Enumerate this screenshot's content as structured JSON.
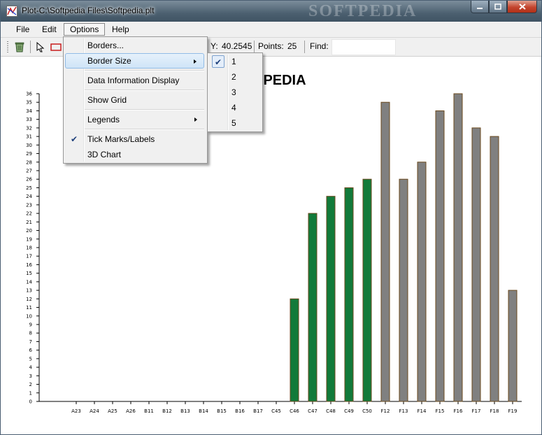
{
  "window": {
    "title": "Plot-C:\\Softpedia Files\\Softpedia.plt",
    "watermark": "SOFTPEDIA"
  },
  "menubar": {
    "file": "File",
    "edit": "Edit",
    "options": "Options",
    "help": "Help"
  },
  "toolbar": {
    "y_label": "Y:",
    "y_value": "40.2545",
    "points_label": "Points:",
    "points_value": "25",
    "find_label": "Find:",
    "find_value": ""
  },
  "options_menu": {
    "borders": "Borders...",
    "border_size": "Border Size",
    "data_info": "Data Information Display",
    "show_grid": "Show Grid",
    "legends": "Legends",
    "tick_marks": "Tick Marks/Labels",
    "chart_3d": "3D Chart"
  },
  "border_size_menu": {
    "items": [
      "1",
      "2",
      "3",
      "4",
      "5"
    ],
    "checked": "1"
  },
  "chart_data": {
    "type": "bar",
    "title": "SOFTPEDIA",
    "visible_title": "PEDIA",
    "ylim": [
      0,
      36
    ],
    "categories": [
      "A23",
      "A24",
      "A25",
      "A26",
      "B11",
      "B12",
      "B13",
      "B14",
      "B15",
      "B16",
      "B17",
      "C45",
      "C46",
      "C47",
      "C48",
      "C49",
      "C50",
      "F12",
      "F13",
      "F14",
      "F15",
      "F16",
      "F17",
      "F18",
      "F19"
    ],
    "values": [
      0,
      0,
      0,
      0,
      0,
      0,
      0,
      0,
      0,
      0,
      0,
      0,
      12,
      22,
      24,
      25,
      26,
      35,
      26,
      28,
      34,
      36,
      32,
      31,
      13
    ],
    "colors": [
      "#127a3a",
      "#127a3a",
      "#127a3a",
      "#127a3a",
      "#127a3a",
      "#127a3a",
      "#127a3a",
      "#127a3a",
      "#127a3a",
      "#127a3a",
      "#127a3a",
      "#127a3a",
      "#127a3a",
      "#127a3a",
      "#127a3a",
      "#127a3a",
      "#127a3a",
      "#808080",
      "#808080",
      "#808080",
      "#808080",
      "#808080",
      "#808080",
      "#808080",
      "#808080"
    ],
    "bar_border_color": "#6b4a1e",
    "grid": false
  }
}
